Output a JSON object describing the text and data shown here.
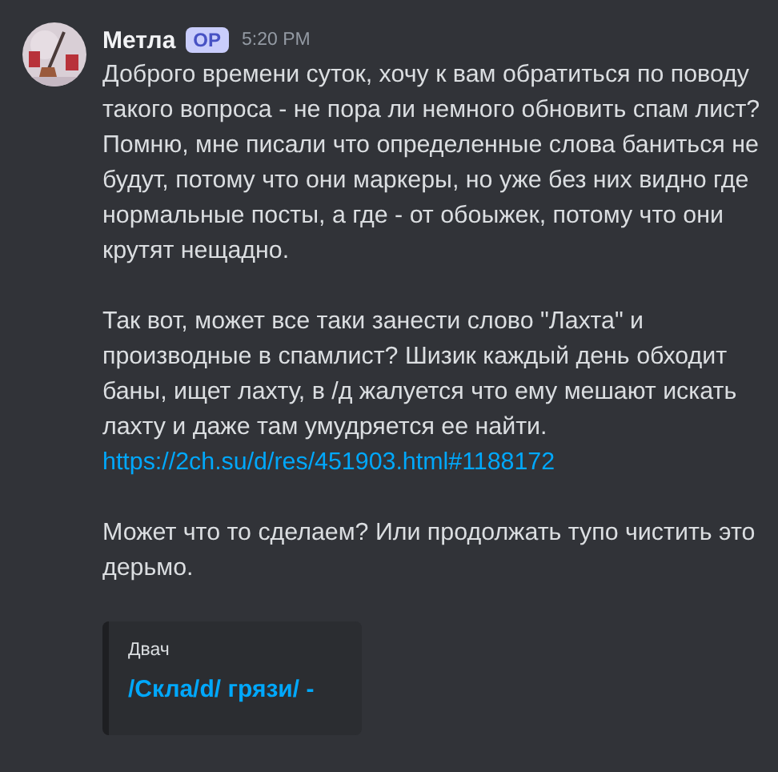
{
  "message": {
    "author": "Метла",
    "badge": "OP",
    "timestamp": "5:20 PM",
    "avatar": {
      "kind": "picture"
    },
    "groups": [
      [
        {
          "kind": "text",
          "text": "Доброго времени суток, хочу к вам обратиться по поводу такого вопроса - не пора ли немного обновить спам лист?"
        },
        {
          "kind": "text",
          "text": "Помню, мне писали что определенные слова баниться не будут, потому что они маркеры, но уже без них видно где нормальные посты, а где - от обоыжек, потому что они крутят нещадно."
        }
      ],
      [
        {
          "kind": "text",
          "text": "Так вот, может все таки занести слово \"Лахта\" и производные в спамлист? Шизик каждый день обходит баны, ищет лахту, в /д жалуется что ему мешают искать лахту и даже там умудряется ее найти."
        },
        {
          "kind": "link",
          "text": "https://2ch.su/d/res/451903.html#1188172"
        }
      ],
      [
        {
          "kind": "text",
          "text": "Может что то сделаем? Или продолжать тупо чистить это дерьмо."
        }
      ]
    ],
    "embed": {
      "provider": "Двач",
      "title": "/Скла/d/ грязи/ -"
    }
  }
}
